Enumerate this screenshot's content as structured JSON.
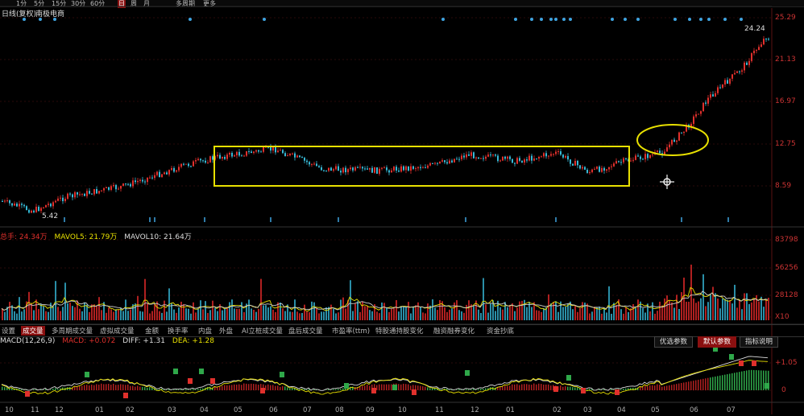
{
  "header": {
    "stock_title": "日线(复权)",
    "stock_name": "南极电商",
    "top_items": [
      "1分",
      "5分",
      "15分",
      "30分",
      "60分",
      "日",
      "周",
      "月",
      "多周期",
      "更多"
    ]
  },
  "price_axis": [
    "25.29",
    "21.13",
    "16.97",
    "12.75",
    "8.59"
  ],
  "price_markers": {
    "high": "24.24",
    "low": "5.42"
  },
  "volume_info": {
    "total": "总手: 24.34万",
    "mavol5": "MAVOL5: 21.79万",
    "mavol10": "MAVOL10: 21.64万"
  },
  "volume_axis": [
    "83798",
    "56256",
    "28128",
    "X10"
  ],
  "indicator_tabs": [
    "设置",
    "成交量",
    "多周期成交量",
    "虚拟成交量",
    "金额",
    "换手率",
    "内盘",
    "外盘",
    "AI立桩成交量",
    "盘后成交量",
    "市盈率(ttm)",
    "特股通持股变化",
    "融资融券变化",
    "资金抄底"
  ],
  "indicator_buttons": [
    "优选参数",
    "默认参数",
    "指标说明"
  ],
  "macd_info": {
    "title": "MACD(12,26,9)",
    "macd": "MACD: +0.072",
    "diff": "DIFF: +1.31",
    "dea": "DEA: +1.28"
  },
  "macd_axis": [
    "+1.05",
    "0"
  ],
  "dates": [
    "10",
    "11",
    "12",
    "01",
    "02",
    "03",
    "04",
    "05",
    "06",
    "07",
    "08",
    "09",
    "10",
    "11",
    "12",
    "01",
    "02",
    "03",
    "04",
    "05",
    "06",
    "07"
  ],
  "colors": {
    "up": "#e0302c",
    "down": "#37b9d6",
    "highlight": "#e8e000",
    "ma5": "#e8e000",
    "ma10": "#cccccc"
  },
  "icons": {
    "crosshair": "move-crosshair-icon"
  }
}
